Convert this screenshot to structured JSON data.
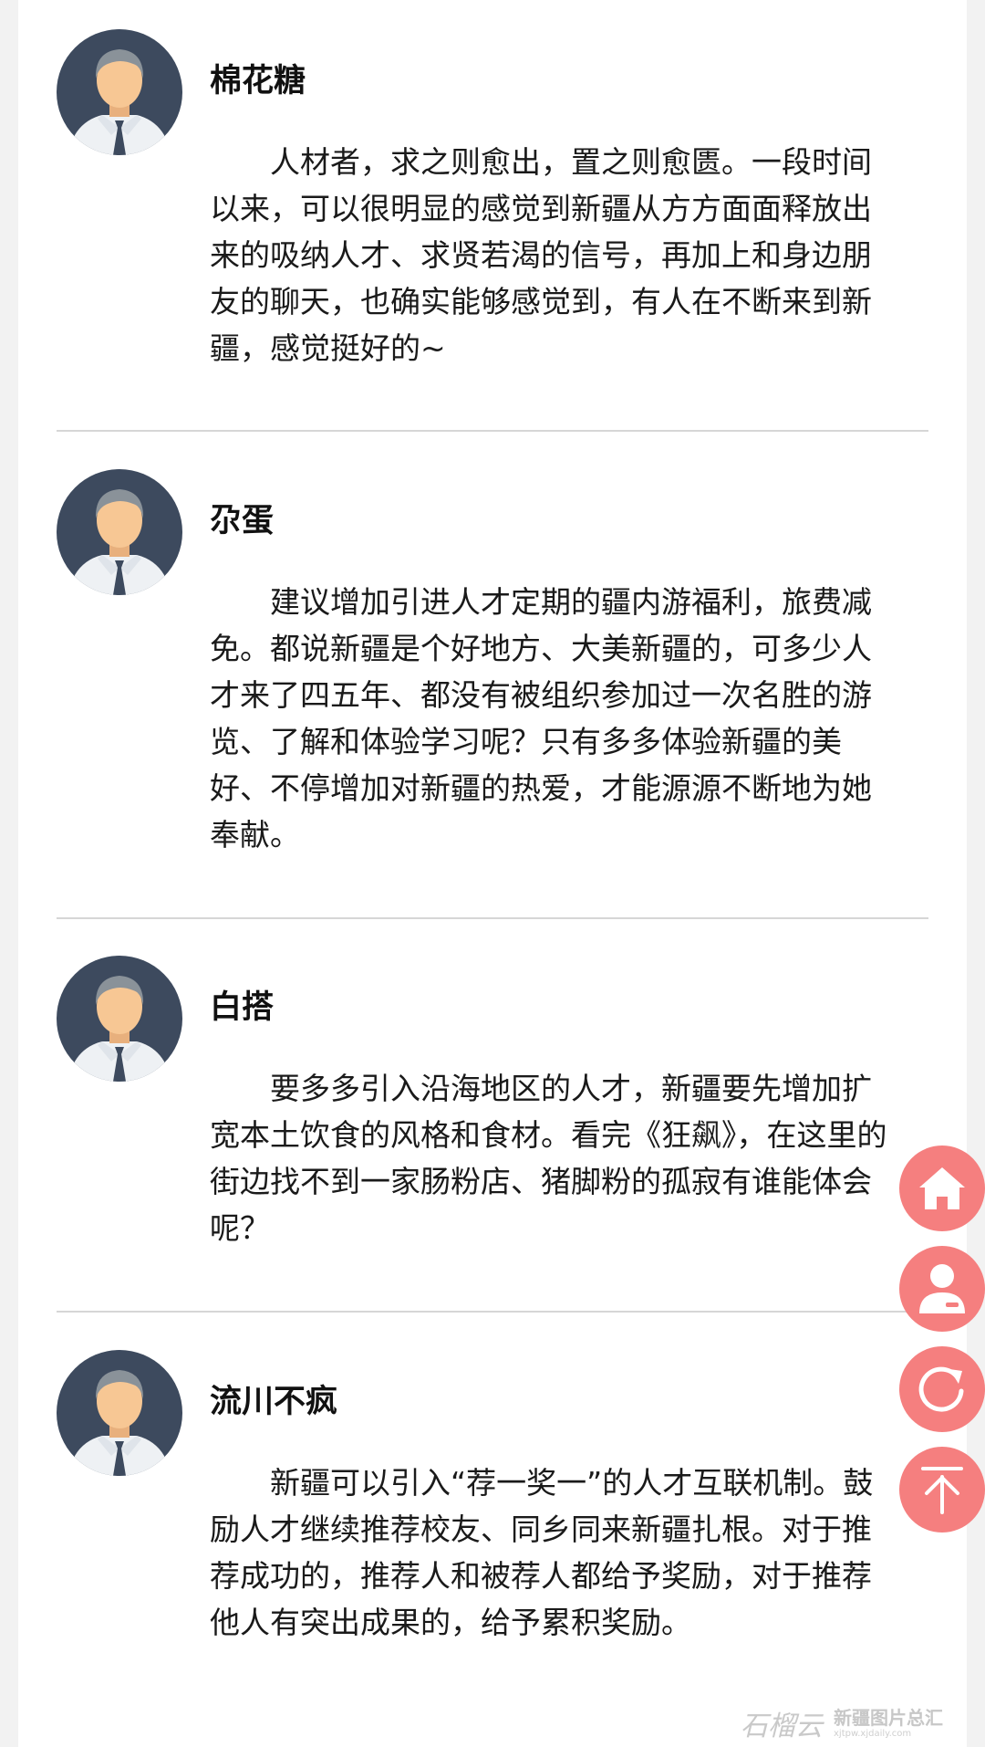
{
  "comments": [
    {
      "name": "棉花糖",
      "text": "人材者，求之则愈出，置之则愈匮。一段时间以来，可以很明显的感觉到新疆从方方面面释放出来的吸纳人才、求贤若渴的信号，再加上和身边朋友的聊天，也确实能够感觉到，有人在不断来到新疆，感觉挺好的~"
    },
    {
      "name": "尕蛋",
      "text": "建议增加引进人才定期的疆内游福利，旅费减免。都说新疆是个好地方、大美新疆的，可多少人才来了四五年、都没有被组织参加过一次名胜的游览、了解和体验学习呢？只有多多体验新疆的美好、不停增加对新疆的热爱，才能源源不断地为她奉献。"
    },
    {
      "name": "白搭",
      "text": "要多多引入沿海地区的人才，新疆要先增加扩宽本土饮食的风格和食材。看完《狂飙》，在这里的街边找不到一家肠粉店、猪脚粉的孤寂有谁能体会呢？"
    },
    {
      "name": "流川不疯",
      "text": "新疆可以引入“荐一奖一”的人才互联机制。鼓励人才继续推荐校友、同乡同来新疆扎根。对于推荐成功的，推荐人和被荐人都给予奖励，对于推荐他人有突出成果的，给予累积奖励。"
    }
  ],
  "floating_buttons": [
    {
      "icon": "home-icon"
    },
    {
      "icon": "user-icon"
    },
    {
      "icon": "refresh-icon"
    },
    {
      "icon": "back-to-top-icon"
    }
  ],
  "watermark": {
    "logo": "石榴云",
    "title": "新疆图片总汇",
    "url": "xjtpw.xjdaily.com"
  },
  "colors": {
    "fab": "#f57f7f",
    "avatar_bg": "#3d4a5e",
    "skin": "#f7c794",
    "hair": "#8a9299",
    "shirt": "#eef1f4",
    "tie": "#3d4a5e",
    "divider": "#d6d6d6"
  }
}
